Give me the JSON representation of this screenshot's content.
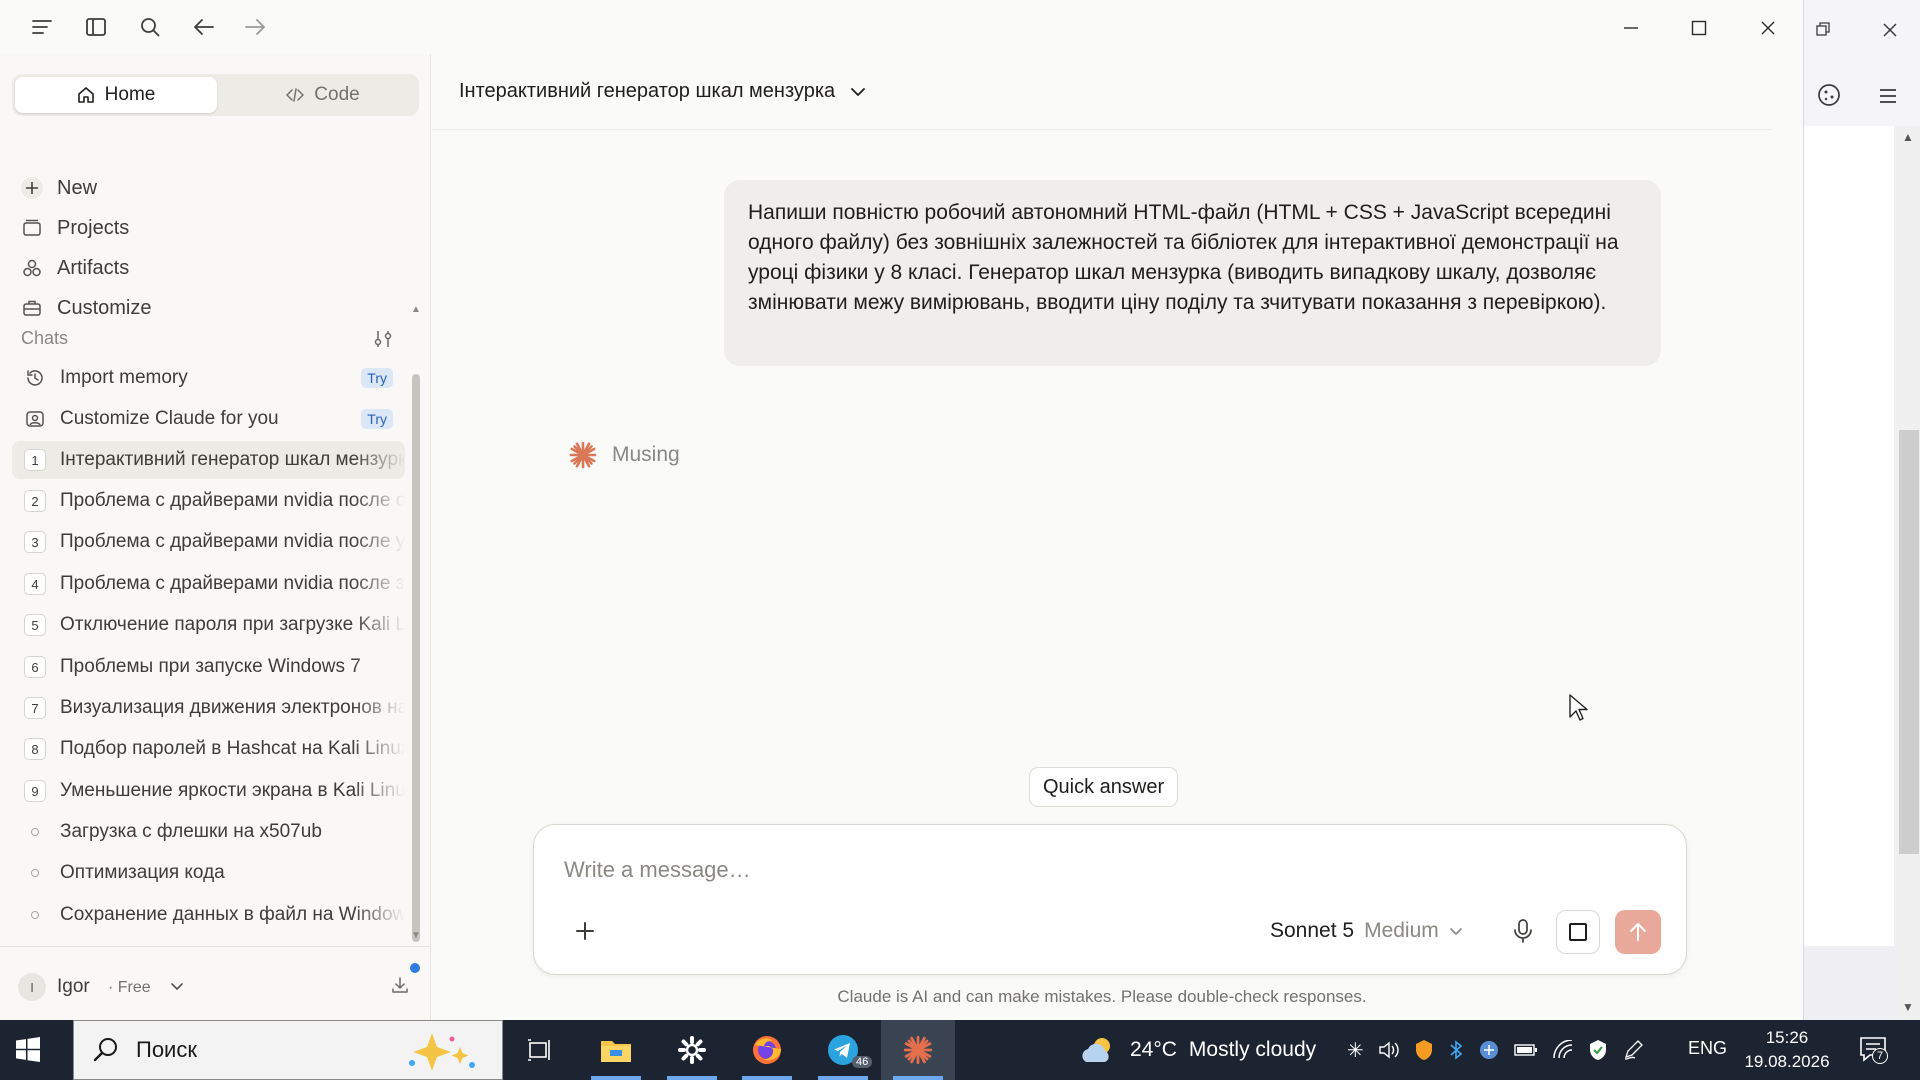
{
  "sidebar": {
    "tabs": [
      {
        "label": "Home",
        "icon": "home-icon",
        "active": true
      },
      {
        "label": "Code",
        "icon": "code-icon",
        "active": false
      }
    ],
    "nav": [
      {
        "label": "New",
        "icon": "plus-icon"
      },
      {
        "label": "Projects",
        "icon": "folder-icon"
      },
      {
        "label": "Artifacts",
        "icon": "artifacts-icon"
      },
      {
        "label": "Customize",
        "icon": "briefcase-icon"
      }
    ],
    "chats_label": "Chats",
    "promos": [
      {
        "label": "Import memory",
        "badge": "Try",
        "icon": "import-memory-icon"
      },
      {
        "label": "Customize Claude for you",
        "badge": "Try",
        "icon": "customize-claude-icon"
      }
    ],
    "chats": [
      {
        "num": "1",
        "label": "Інтерактивний генератор шкал мензурка",
        "active": true
      },
      {
        "num": "2",
        "label": "Проблема с драйверами nvidia после обновления"
      },
      {
        "num": "3",
        "label": "Проблема с драйверами nvidia после установки"
      },
      {
        "num": "4",
        "label": "Проблема с драйверами nvidia после загрузки"
      },
      {
        "num": "5",
        "label": "Отключение пароля при загрузке Kali Linux"
      },
      {
        "num": "6",
        "label": "Проблемы при запуске Windows 7"
      },
      {
        "num": "7",
        "label": "Визуализация движения электронов на схеме"
      },
      {
        "num": "8",
        "label": "Подбор паролей в Hashcat на Kali Linux"
      },
      {
        "num": "9",
        "label": "Уменьшение яркости экрана в Kali Linux"
      },
      {
        "num": "",
        "label": "Загрузка с флешки на x507ub"
      },
      {
        "num": "",
        "label": "Оптимизация кода"
      },
      {
        "num": "",
        "label": "Сохранение данных в файл на Windows"
      }
    ],
    "user": {
      "initial": "I",
      "name": "Igor",
      "plan": "· Free"
    }
  },
  "main": {
    "title": "Інтерактивний генератор шкал мензурка",
    "user_message": "Напиши повністю робочий автономний HTML-файл (HTML + CSS + JavaScript всередині одного файлу) без зовнішніх залежностей та бібліотек для інтерактивної демонстрації на уроці фізики у 8 класі. Генератор шкал мензурка (виводить випадкову шкалу, дозволяє змінювати межу вимірювань, вводити ціну поділу та зчитувати показання з перевіркою).",
    "status": "Musing",
    "quick_answer": "Quick answer",
    "composer": {
      "placeholder": "Write a message…",
      "model": "Sonnet 5",
      "effort": "Medium"
    },
    "disclaimer": "Claude is AI and can make mistakes. Please double-check responses."
  },
  "taskbar": {
    "search_placeholder": "Поиск",
    "weather_temp": "24°C",
    "weather_text": "Mostly cloudy",
    "lang": "ENG",
    "time": "15:26",
    "date": "19.08.2026",
    "telegram_badge": "46",
    "notif_count": "7"
  },
  "colors": {
    "accent": "#d97757",
    "send_disabled": "#e8a99a",
    "badge_bg": "#dbe7f7",
    "badge_fg": "#2b62b8",
    "taskbar_bg": "#1c2432"
  }
}
